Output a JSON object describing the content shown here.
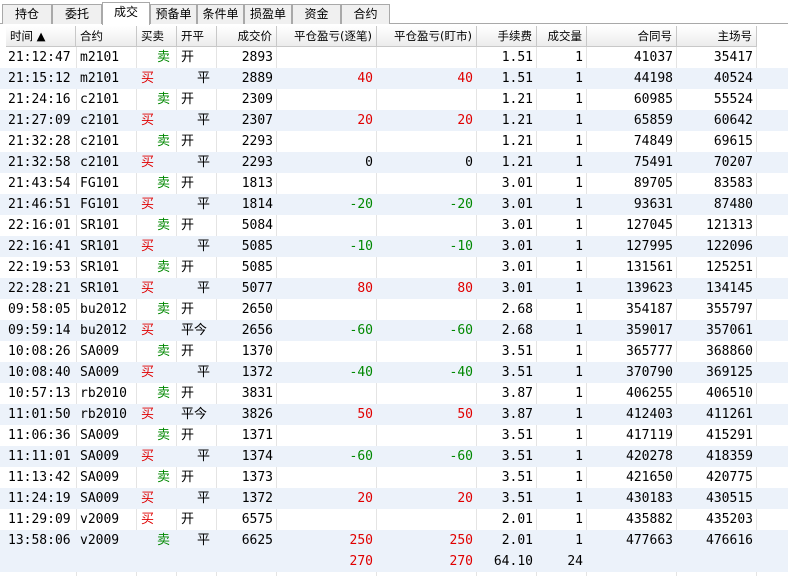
{
  "tabs": [
    {
      "label": "持仓",
      "active": false
    },
    {
      "label": "委托",
      "active": false
    },
    {
      "label": "成交",
      "active": true
    },
    {
      "label": "预备单",
      "active": false
    },
    {
      "label": "条件单",
      "active": false
    },
    {
      "label": "损盈单",
      "active": false
    },
    {
      "label": "资金",
      "active": false
    },
    {
      "label": "合约",
      "active": false
    }
  ],
  "columns": {
    "time": "时间 ▲",
    "contract": "合约",
    "side": "买卖",
    "offset": "开平",
    "price": "成交价",
    "pnl_trade": "平仓盈亏(逐笔)",
    "pnl_mark": "平仓盈亏(盯市)",
    "fee": "手续费",
    "volume": "成交量",
    "order_id": "合同号",
    "exchange_id": "主场号"
  },
  "colors": {
    "buy": "#e00000",
    "sell": "#008800",
    "row_alt": "#ecf2fa"
  },
  "trades": [
    {
      "time": "21:12:47",
      "contract": "m2101",
      "side": "卖",
      "offset": "开",
      "price": "2893",
      "pnl_trade": "",
      "pnl_mark": "",
      "fee": "1.51",
      "volume": "1",
      "order_id": "41037",
      "exchange_id": "35417"
    },
    {
      "time": "21:15:12",
      "contract": "m2101",
      "side": "买",
      "offset": "平",
      "price": "2889",
      "pnl_trade": "40",
      "pnl_mark": "40",
      "fee": "1.51",
      "volume": "1",
      "order_id": "44198",
      "exchange_id": "40524"
    },
    {
      "time": "21:24:16",
      "contract": "c2101",
      "side": "卖",
      "offset": "开",
      "price": "2309",
      "pnl_trade": "",
      "pnl_mark": "",
      "fee": "1.21",
      "volume": "1",
      "order_id": "60985",
      "exchange_id": "55524"
    },
    {
      "time": "21:27:09",
      "contract": "c2101",
      "side": "买",
      "offset": "平",
      "price": "2307",
      "pnl_trade": "20",
      "pnl_mark": "20",
      "fee": "1.21",
      "volume": "1",
      "order_id": "65859",
      "exchange_id": "60642"
    },
    {
      "time": "21:32:28",
      "contract": "c2101",
      "side": "卖",
      "offset": "开",
      "price": "2293",
      "pnl_trade": "",
      "pnl_mark": "",
      "fee": "1.21",
      "volume": "1",
      "order_id": "74849",
      "exchange_id": "69615"
    },
    {
      "time": "21:32:58",
      "contract": "c2101",
      "side": "买",
      "offset": "平",
      "price": "2293",
      "pnl_trade": "0",
      "pnl_mark": "0",
      "fee": "1.21",
      "volume": "1",
      "order_id": "75491",
      "exchange_id": "70207"
    },
    {
      "time": "21:43:54",
      "contract": "FG101",
      "side": "卖",
      "offset": "开",
      "price": "1813",
      "pnl_trade": "",
      "pnl_mark": "",
      "fee": "3.01",
      "volume": "1",
      "order_id": "89705",
      "exchange_id": "83583"
    },
    {
      "time": "21:46:51",
      "contract": "FG101",
      "side": "买",
      "offset": "平",
      "price": "1814",
      "pnl_trade": "-20",
      "pnl_mark": "-20",
      "fee": "3.01",
      "volume": "1",
      "order_id": "93631",
      "exchange_id": "87480"
    },
    {
      "time": "22:16:01",
      "contract": "SR101",
      "side": "卖",
      "offset": "开",
      "price": "5084",
      "pnl_trade": "",
      "pnl_mark": "",
      "fee": "3.01",
      "volume": "1",
      "order_id": "127045",
      "exchange_id": "121313"
    },
    {
      "time": "22:16:41",
      "contract": "SR101",
      "side": "买",
      "offset": "平",
      "price": "5085",
      "pnl_trade": "-10",
      "pnl_mark": "-10",
      "fee": "3.01",
      "volume": "1",
      "order_id": "127995",
      "exchange_id": "122096"
    },
    {
      "time": "22:19:53",
      "contract": "SR101",
      "side": "卖",
      "offset": "开",
      "price": "5085",
      "pnl_trade": "",
      "pnl_mark": "",
      "fee": "3.01",
      "volume": "1",
      "order_id": "131561",
      "exchange_id": "125251"
    },
    {
      "time": "22:28:21",
      "contract": "SR101",
      "side": "买",
      "offset": "平",
      "price": "5077",
      "pnl_trade": "80",
      "pnl_mark": "80",
      "fee": "3.01",
      "volume": "1",
      "order_id": "139623",
      "exchange_id": "134145"
    },
    {
      "time": "09:58:05",
      "contract": "bu2012",
      "side": "卖",
      "offset": "开",
      "price": "2650",
      "pnl_trade": "",
      "pnl_mark": "",
      "fee": "2.68",
      "volume": "1",
      "order_id": "354187",
      "exchange_id": "355797"
    },
    {
      "time": "09:59:14",
      "contract": "bu2012",
      "side": "买",
      "offset": "平今",
      "price": "2656",
      "pnl_trade": "-60",
      "pnl_mark": "-60",
      "fee": "2.68",
      "volume": "1",
      "order_id": "359017",
      "exchange_id": "357061"
    },
    {
      "time": "10:08:26",
      "contract": "SA009",
      "side": "卖",
      "offset": "开",
      "price": "1370",
      "pnl_trade": "",
      "pnl_mark": "",
      "fee": "3.51",
      "volume": "1",
      "order_id": "365777",
      "exchange_id": "368860"
    },
    {
      "time": "10:08:40",
      "contract": "SA009",
      "side": "买",
      "offset": "平",
      "price": "1372",
      "pnl_trade": "-40",
      "pnl_mark": "-40",
      "fee": "3.51",
      "volume": "1",
      "order_id": "370790",
      "exchange_id": "369125"
    },
    {
      "time": "10:57:13",
      "contract": "rb2010",
      "side": "卖",
      "offset": "开",
      "price": "3831",
      "pnl_trade": "",
      "pnl_mark": "",
      "fee": "3.87",
      "volume": "1",
      "order_id": "406255",
      "exchange_id": "406510"
    },
    {
      "time": "11:01:50",
      "contract": "rb2010",
      "side": "买",
      "offset": "平今",
      "price": "3826",
      "pnl_trade": "50",
      "pnl_mark": "50",
      "fee": "3.87",
      "volume": "1",
      "order_id": "412403",
      "exchange_id": "411261"
    },
    {
      "time": "11:06:36",
      "contract": "SA009",
      "side": "卖",
      "offset": "开",
      "price": "1371",
      "pnl_trade": "",
      "pnl_mark": "",
      "fee": "3.51",
      "volume": "1",
      "order_id": "417119",
      "exchange_id": "415291"
    },
    {
      "time": "11:11:01",
      "contract": "SA009",
      "side": "买",
      "offset": "平",
      "price": "1374",
      "pnl_trade": "-60",
      "pnl_mark": "-60",
      "fee": "3.51",
      "volume": "1",
      "order_id": "420278",
      "exchange_id": "418359"
    },
    {
      "time": "11:13:42",
      "contract": "SA009",
      "side": "卖",
      "offset": "开",
      "price": "1373",
      "pnl_trade": "",
      "pnl_mark": "",
      "fee": "3.51",
      "volume": "1",
      "order_id": "421650",
      "exchange_id": "420775"
    },
    {
      "time": "11:24:19",
      "contract": "SA009",
      "side": "买",
      "offset": "平",
      "price": "1372",
      "pnl_trade": "20",
      "pnl_mark": "20",
      "fee": "3.51",
      "volume": "1",
      "order_id": "430183",
      "exchange_id": "430515"
    },
    {
      "time": "11:29:09",
      "contract": "v2009",
      "side": "买",
      "offset": "开",
      "price": "6575",
      "pnl_trade": "",
      "pnl_mark": "",
      "fee": "2.01",
      "volume": "1",
      "order_id": "435882",
      "exchange_id": "435203"
    },
    {
      "time": "13:58:06",
      "contract": "v2009",
      "side": "卖",
      "offset": "平",
      "price": "6625",
      "pnl_trade": "250",
      "pnl_mark": "250",
      "fee": "2.01",
      "volume": "1",
      "order_id": "477663",
      "exchange_id": "476616"
    }
  ],
  "totals": {
    "pnl_trade": "270",
    "pnl_mark": "270",
    "fee": "64.10",
    "volume": "24"
  }
}
